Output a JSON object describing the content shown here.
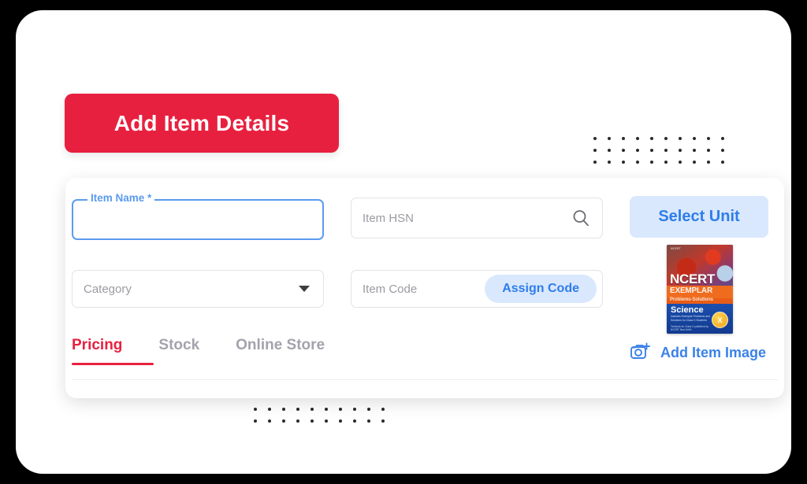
{
  "header": {
    "add_item_button_label": "Add Item Details"
  },
  "form": {
    "item_name": {
      "label": "Item Name *",
      "value": "",
      "placeholder": ""
    },
    "category": {
      "placeholder": "Category",
      "value": "",
      "caret_icon": "chevron-down-icon"
    },
    "item_hsn": {
      "placeholder": "Item HSN",
      "value": "",
      "search_icon": "search-icon"
    },
    "item_code": {
      "placeholder": "Item Code",
      "value": "",
      "assign_button_label": "Assign Code"
    },
    "select_unit_label": "Select Unit"
  },
  "tabs": [
    {
      "label": "Pricing",
      "active": true
    },
    {
      "label": "Stock",
      "active": false
    },
    {
      "label": "Online Store",
      "active": false
    }
  ],
  "image_upload": {
    "label": "Add Item Image",
    "icon": "camera-plus-icon"
  },
  "book_thumbnail": {
    "brand_line": "NCERT",
    "title": "NCERT",
    "series": "EXEMPLAR",
    "subtitle": "Problems-Solutions",
    "subject": "Science",
    "description": "Includes Exemplar Problems and Solutions for Class X Students",
    "author_line": "Textbook for Class X published by NCERT New Delhi",
    "class_badge": "X"
  },
  "colors": {
    "brand_red": "#e8203f",
    "accent_blue": "#3b82e8",
    "focus_blue": "#5b9bef",
    "chip_blue_bg": "#d9e8fd",
    "field_border": "#e3e3e6",
    "muted_text": "#9b9ba2",
    "tab_inactive": "#a3a3ac",
    "page_bg": "#ffffff",
    "outer_bg": "#000000"
  },
  "decoration": {
    "dots_top_right": {
      "columns": 10,
      "rows": 3
    },
    "dots_bottom_left": {
      "columns": 10,
      "rows": 2
    }
  }
}
